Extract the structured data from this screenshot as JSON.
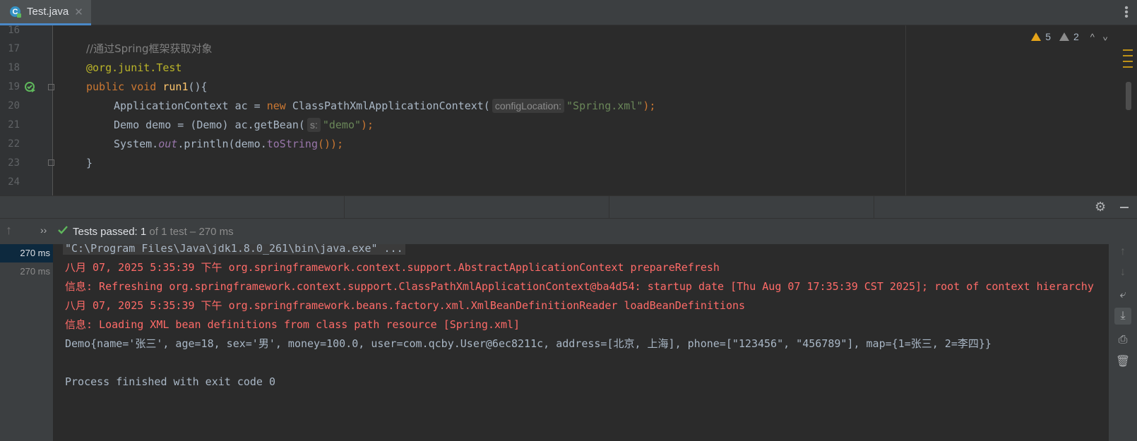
{
  "tab": {
    "file_name": "Test.java",
    "close_glyph": "✕",
    "icon_letter": "C"
  },
  "editor": {
    "line_numbers": [
      "16",
      "17",
      "18",
      "19",
      "20",
      "21",
      "22",
      "23",
      "24"
    ],
    "code": {
      "l17_comment": "//通过Spring框架获取对象",
      "l18_annotation": "@org.junit.",
      "l18_annotation_name": "Test",
      "l19_kw1": "public",
      "l19_kw2": "void",
      "l19_fn": "run1",
      "l19_rest": "(){",
      "l20_a": "ApplicationContext ac = ",
      "l20_new": "new",
      "l20_b": " ClassPathXmlApplicationContext(",
      "l20_hint": "configLocation:",
      "l20_str": "\"Spring.xml\"",
      "l20_end": ");",
      "l21_a": "Demo demo = (Demo) ac.getBean(",
      "l21_hint": "s:",
      "l21_str": "\"demo\"",
      "l21_end": ");",
      "l22_a": "System.",
      "l22_out": "out",
      "l22_b": ".println(demo.",
      "l22_meth": "toString",
      "l22_end": "());",
      "l23": "}"
    },
    "inspections": {
      "warnings": "5",
      "weak_warnings": "2",
      "nav_up": "^"
    }
  },
  "run": {
    "status_label": "Tests passed: ",
    "status_count": "1",
    "status_detail": " of 1 test – 270 ms",
    "tree": [
      {
        "label": "270 ms",
        "selected": true
      },
      {
        "label": "270 ms",
        "selected": false
      }
    ],
    "console": {
      "cmd": "\"C:\\Program Files\\Java\\jdk1.8.0_261\\bin\\java.exe\" ...",
      "err1": "八月 07, 2025 5:35:39 下午 org.springframework.context.support.AbstractApplicationContext prepareRefresh",
      "err2": "信息: Refreshing org.springframework.context.support.ClassPathXmlApplicationContext@ba4d54: startup date [Thu Aug 07 17:35:39 CST 2025]; root of context hierarchy",
      "err3": "八月 07, 2025 5:35:39 下午 org.springframework.beans.factory.xml.XmlBeanDefinitionReader loadBeanDefinitions",
      "err4": "信息: Loading XML bean definitions from class path resource [Spring.xml]",
      "out1": "Demo{name='张三', age=18, sex='男', money=100.0, user=com.qcby.User@6ec8211c, address=[北京, 上海], phone=[\"123456\", \"456789\"], map={1=张三, 2=李四}}",
      "out2": "Process finished with exit code 0"
    }
  },
  "colors": {
    "accent": "#4a88c7",
    "pass_green": "#5fb85c",
    "error_red": "#ff6b68",
    "warning": "#e5a419"
  }
}
